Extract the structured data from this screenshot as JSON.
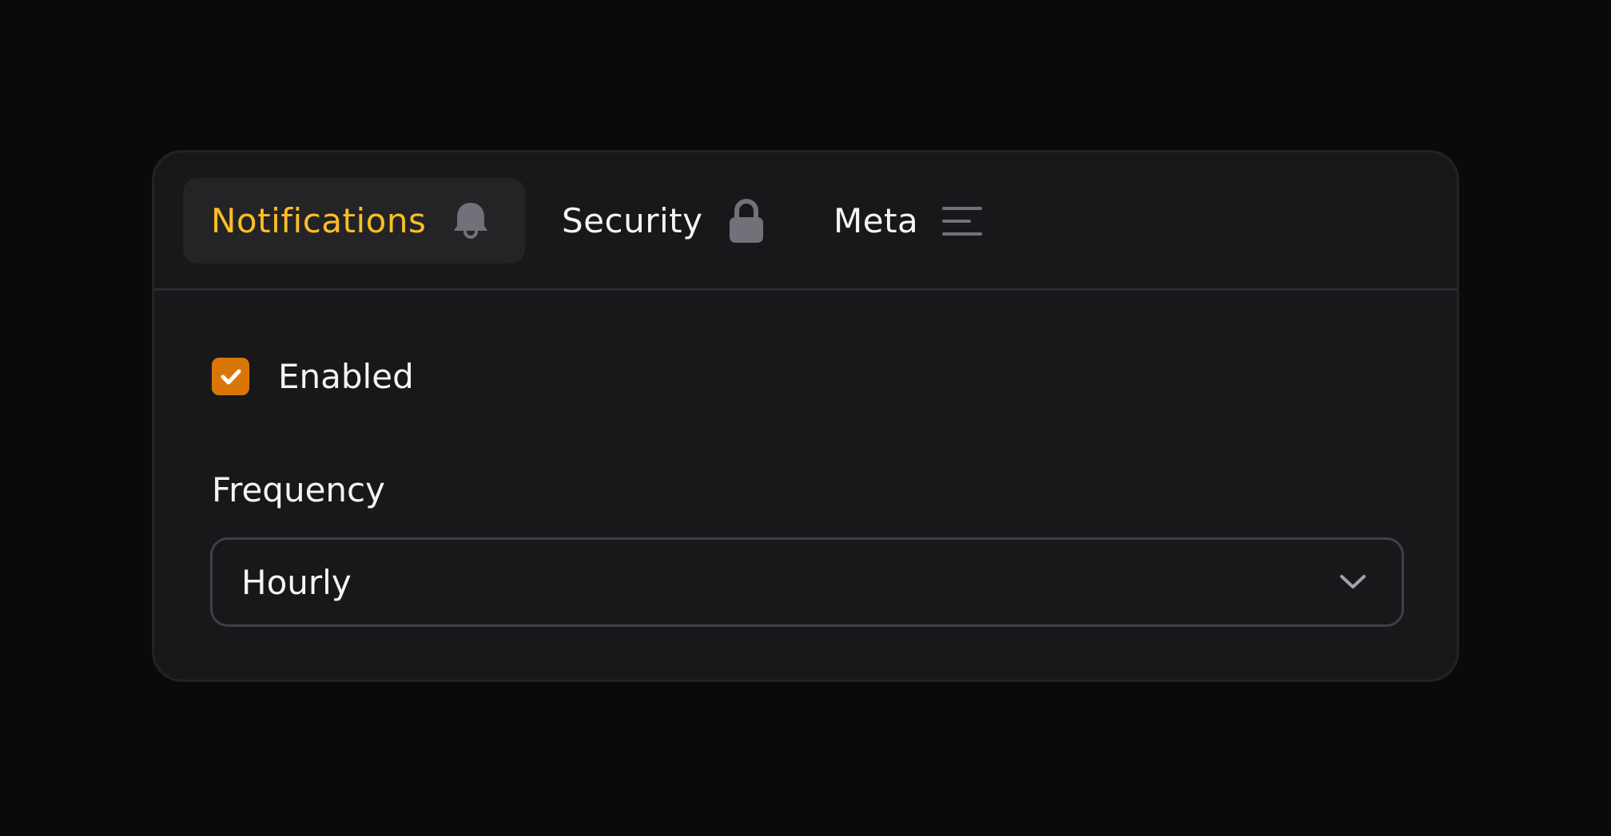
{
  "tabs": [
    {
      "label": "Notifications",
      "icon": "bell-icon",
      "active": true
    },
    {
      "label": "Security",
      "icon": "lock-icon",
      "active": false
    },
    {
      "label": "Meta",
      "icon": "menu-lines-icon",
      "active": false
    }
  ],
  "notifications": {
    "enabled_label": "Enabled",
    "enabled_checked": true,
    "frequency_label": "Frequency",
    "frequency_value": "Hourly"
  },
  "colors": {
    "accent": "#fbbf24",
    "checkbox": "#d97706",
    "background": "#0a0a0d",
    "card": "#18181b",
    "icon": "#71717a"
  }
}
